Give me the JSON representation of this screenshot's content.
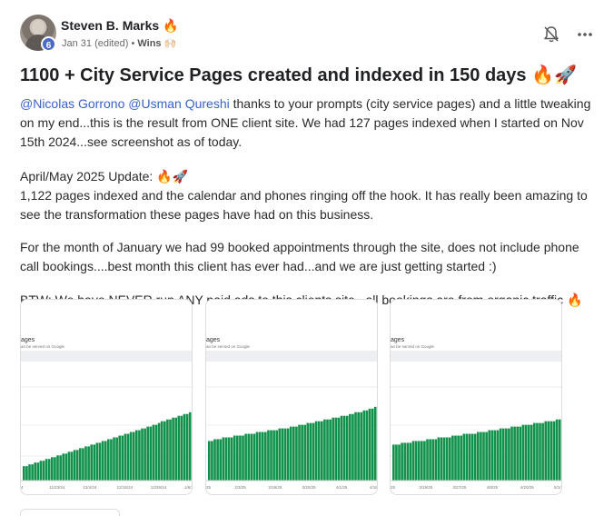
{
  "post": {
    "author": "Steven B. Marks 🔥",
    "level": "6",
    "date": "Jan 31 (edited)",
    "separator": " • ",
    "category": "Wins 🙌🏻",
    "title": "1100 + City Service Pages created and indexed in 150 days 🔥🚀"
  },
  "body": {
    "mention1": "@Nicolas Gorrono",
    "mention2": "@Usman Qureshi",
    "p1_rest": " thanks to your prompts (city service pages) and a little tweaking on my end...this is the result from ONE client site. We had 127 pages indexed when I started on Nov 15th 2024...see screenshot as of today.",
    "p2_head": "April/May 2025 Update: 🔥🚀",
    "p2_body": "1,122 pages indexed and the calendar and phones ringing off the hook. It has really been amazing to see the transformation these pages have had on this business.",
    "p3": "For the month of January we had 99 booked appointments through the site, does not include phone call bookings....best month this client has ever had...and we are just getting started :)",
    "p4": "BTW: We have NEVER run ANY paid ads to this clients site...all bookings are from organic traffic 🔥"
  },
  "chart_data": [
    {
      "type": "bar",
      "title": "ages",
      "subtitle": "an be served on Google",
      "x_ticks": [
        "4",
        "11/23/24",
        "12/4/24",
        "12/15/24",
        "12/26/24",
        "1/6/25"
      ],
      "values": [
        8,
        8,
        9,
        9,
        10,
        10,
        11,
        11,
        12,
        12,
        13,
        13,
        14,
        14,
        15,
        15,
        16,
        16,
        17,
        17,
        18,
        18,
        19,
        19,
        20,
        20,
        21,
        21,
        22,
        22,
        23,
        23,
        24,
        24,
        25,
        25,
        26,
        26,
        27,
        27,
        28,
        28,
        29,
        29,
        30,
        30,
        31,
        31,
        32,
        33,
        33,
        34,
        34,
        35,
        35,
        36,
        36,
        37,
        37,
        38
      ],
      "color": "#119149"
    },
    {
      "type": "bar",
      "title": "ages",
      "subtitle": "an be served on Google",
      "x_ticks": [
        "25",
        "2/3/25",
        "2/19/25",
        "3/20/25",
        "4/1/25",
        "4/18/25"
      ],
      "values": [
        22,
        22,
        23,
        23,
        23,
        24,
        24,
        24,
        24,
        25,
        25,
        25,
        25,
        26,
        26,
        26,
        26,
        27,
        27,
        27,
        27,
        28,
        28,
        28,
        28,
        29,
        29,
        29,
        29,
        30,
        30,
        30,
        31,
        31,
        31,
        32,
        32,
        32,
        33,
        33,
        33,
        34,
        34,
        34,
        35,
        35,
        35,
        36,
        36,
        36,
        37,
        37,
        38,
        38,
        38,
        39,
        39,
        40,
        40,
        41
      ],
      "color": "#119149"
    },
    {
      "type": "bar",
      "title": "ages",
      "subtitle": "an be served on Google",
      "x_ticks": [
        "25",
        "3/19/25",
        "3/27/25",
        "4/8/25",
        "4/20/25",
        "5/1/25"
      ],
      "values": [
        20,
        20,
        20,
        21,
        21,
        21,
        21,
        22,
        22,
        22,
        22,
        22,
        23,
        23,
        23,
        23,
        24,
        24,
        24,
        24,
        24,
        25,
        25,
        25,
        25,
        26,
        26,
        26,
        26,
        26,
        27,
        27,
        27,
        27,
        28,
        28,
        28,
        28,
        29,
        29,
        29,
        29,
        30,
        30,
        30,
        30,
        31,
        31,
        31,
        31,
        32,
        32,
        32,
        32,
        33,
        33,
        33,
        33,
        34,
        34
      ],
      "color": "#119149"
    }
  ]
}
